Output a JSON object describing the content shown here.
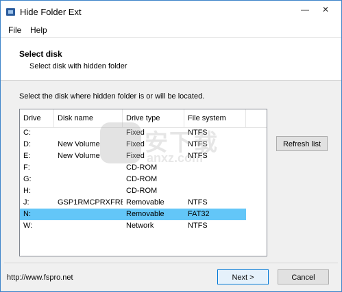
{
  "window": {
    "title": "Hide Folder Ext"
  },
  "menu": {
    "items": [
      "File",
      "Help"
    ]
  },
  "header": {
    "title": "Select disk",
    "subtitle": "Select disk with hidden folder"
  },
  "instruction": "Select the disk where hidden folder is or will be located.",
  "list": {
    "columns": [
      "Drive",
      "Disk name",
      "Drive type",
      "File system"
    ],
    "rows": [
      {
        "drive": "C:",
        "name": "",
        "type": "Fixed",
        "fs": "NTFS",
        "selected": false
      },
      {
        "drive": "D:",
        "name": "New Volume",
        "type": "Fixed",
        "fs": "NTFS",
        "selected": false
      },
      {
        "drive": "E:",
        "name": "New Volume",
        "type": "Fixed",
        "fs": "NTFS",
        "selected": false
      },
      {
        "drive": "F:",
        "name": "",
        "type": "CD-ROM",
        "fs": "",
        "selected": false
      },
      {
        "drive": "G:",
        "name": "",
        "type": "CD-ROM",
        "fs": "",
        "selected": false
      },
      {
        "drive": "H:",
        "name": "",
        "type": "CD-ROM",
        "fs": "",
        "selected": false
      },
      {
        "drive": "J:",
        "name": "GSP1RMCPRXFRE...",
        "type": "Removable",
        "fs": "NTFS",
        "selected": false
      },
      {
        "drive": "N:",
        "name": "",
        "type": "Removable",
        "fs": "FAT32",
        "selected": true
      },
      {
        "drive": "W:",
        "name": "",
        "type": "Network",
        "fs": "NTFS",
        "selected": false
      }
    ]
  },
  "buttons": {
    "refresh": "Refresh list",
    "next": "Next >",
    "cancel": "Cancel"
  },
  "footer": {
    "link": "http://www.fspro.net"
  },
  "watermark": {
    "text": "安下载",
    "sub": "anxz.com"
  },
  "colors": {
    "selection": "#63c6f8",
    "frame": "#3c83c9"
  }
}
